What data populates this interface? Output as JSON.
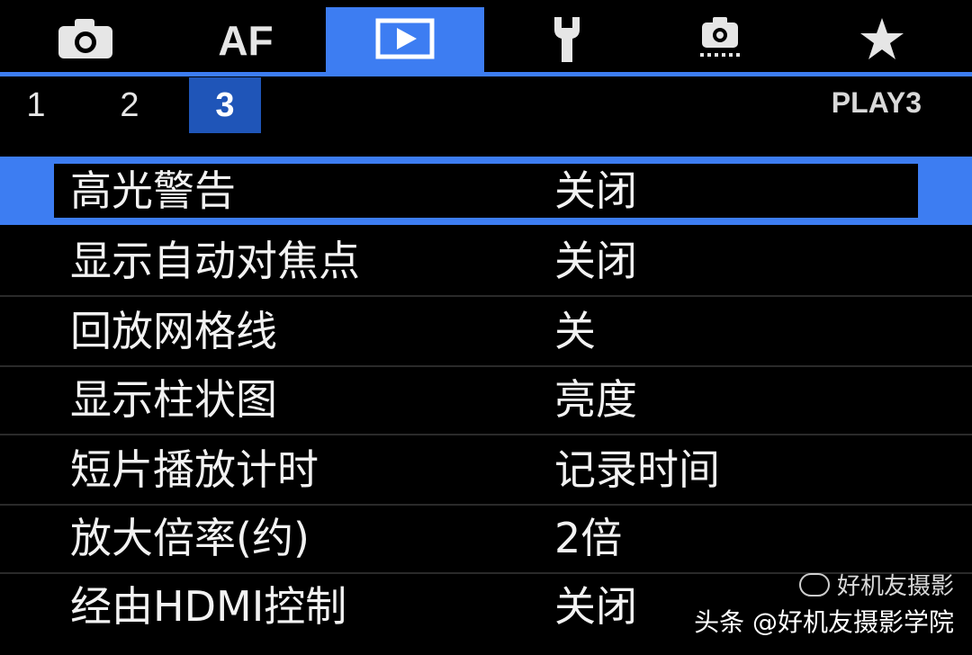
{
  "top_tabs": [
    {
      "id": "shooting",
      "icon": "camera-icon",
      "label": ""
    },
    {
      "id": "af",
      "icon": "",
      "label": "AF"
    },
    {
      "id": "playback",
      "icon": "playback-icon",
      "label": "",
      "active": true
    },
    {
      "id": "setup",
      "icon": "wrench-icon",
      "label": ""
    },
    {
      "id": "custom",
      "icon": "custom-function-camera-icon",
      "label": ""
    },
    {
      "id": "mymenu",
      "icon": "star-icon",
      "label": ""
    }
  ],
  "sub_tabs": {
    "items": [
      "1",
      "2",
      "3"
    ],
    "active_index": 2
  },
  "page_id": "PLAY3",
  "menu": {
    "selected_index": 0,
    "items": [
      {
        "label": "高光警告",
        "value": "关闭"
      },
      {
        "label": "显示自动对焦点",
        "value": "关闭"
      },
      {
        "label": "回放网格线",
        "value": "关"
      },
      {
        "label": "显示柱状图",
        "value": "亮度"
      },
      {
        "label": "短片播放计时",
        "value": "记录时间"
      },
      {
        "label": "放大倍率(约)",
        "value": "2倍"
      },
      {
        "label": "经由HDMI控制",
        "value": "关闭"
      }
    ]
  },
  "watermark": {
    "line1": "好机友摄影",
    "line2": "头条 @好机友摄影学院"
  },
  "colors": {
    "accent": "#3d7df2",
    "subtab_active": "#1f55b8",
    "background": "#000000",
    "text": "#f2f2f2"
  }
}
